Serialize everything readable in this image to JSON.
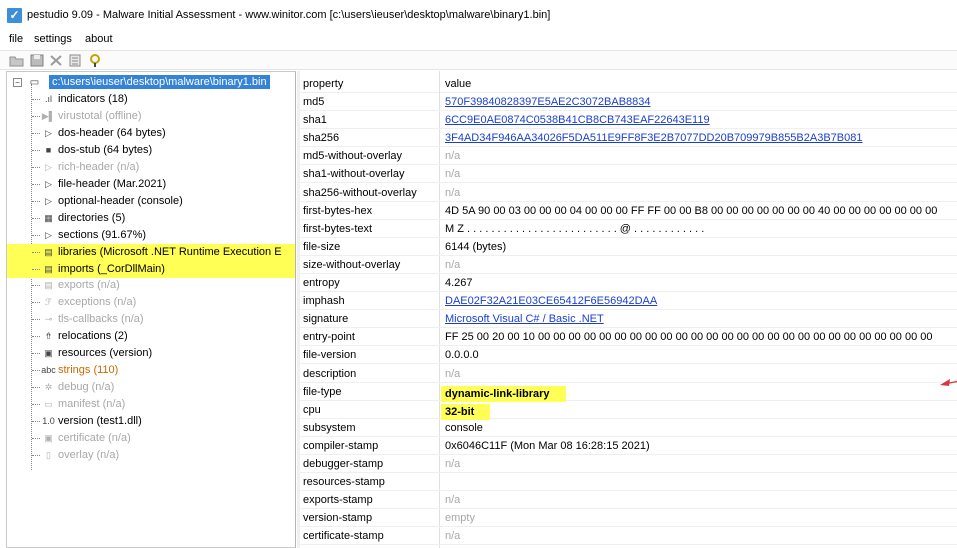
{
  "window": {
    "title": "pestudio 9.09 - Malware Initial Assessment - www.winitor.com [c:\\users\\ieuser\\desktop\\malware\\binary1.bin]"
  },
  "menu": [
    "file",
    "settings",
    "about"
  ],
  "toolbar": [
    "open-icon",
    "save-icon",
    "close-icon",
    "list-icon",
    "help-icon"
  ],
  "tree": {
    "root": "c:\\users\\ieuser\\desktop\\malware\\binary1.bin",
    "items": [
      {
        "label": "indicators (18)",
        "style": "normal",
        "icon": "indicators-icon",
        "glyph": ".ıl"
      },
      {
        "label": "virustotal (offline)",
        "style": "muted",
        "icon": "virustotal-icon",
        "glyph": "▶▌"
      },
      {
        "label": "dos-header (64 bytes)",
        "style": "normal",
        "icon": "arrow-icon",
        "glyph": "▷"
      },
      {
        "label": "dos-stub (64 bytes)",
        "style": "normal",
        "icon": "console-icon",
        "glyph": "■"
      },
      {
        "label": "rich-header (n/a)",
        "style": "muted",
        "icon": "arrow-icon",
        "glyph": "▷"
      },
      {
        "label": "file-header (Mar.2021)",
        "style": "normal",
        "icon": "arrow-icon",
        "glyph": "▷"
      },
      {
        "label": "optional-header (console)",
        "style": "normal",
        "icon": "arrow-icon",
        "glyph": "▷"
      },
      {
        "label": "directories (5)",
        "style": "normal",
        "icon": "directories-icon",
        "glyph": "▦"
      },
      {
        "label": "sections (91.67%)",
        "style": "normal",
        "icon": "arrow-icon",
        "glyph": "▷"
      },
      {
        "label": "libraries (Microsoft .NET Runtime Execution E",
        "style": "normal",
        "icon": "libraries-icon",
        "glyph": "▤",
        "highlight": true
      },
      {
        "label": "imports (_CorDllMain)",
        "style": "normal",
        "icon": "imports-icon",
        "glyph": "▤",
        "highlight": true
      },
      {
        "label": "exports (n/a)",
        "style": "muted",
        "icon": "exports-icon",
        "glyph": "▤"
      },
      {
        "label": "exceptions (n/a)",
        "style": "muted",
        "icon": "exceptions-icon",
        "glyph": "ℱ"
      },
      {
        "label": "tls-callbacks (n/a)",
        "style": "muted",
        "icon": "tls-icon",
        "glyph": "⊸"
      },
      {
        "label": "relocations (2)",
        "style": "normal",
        "icon": "relocations-icon",
        "glyph": "⇮"
      },
      {
        "label": "resources (version)",
        "style": "normal",
        "icon": "resources-icon",
        "glyph": "▣"
      },
      {
        "label": "strings (110)",
        "style": "orange",
        "icon": "strings-icon",
        "glyph": "abc"
      },
      {
        "label": "debug (n/a)",
        "style": "muted",
        "icon": "debug-icon",
        "glyph": "✲"
      },
      {
        "label": "manifest (n/a)",
        "style": "muted",
        "icon": "manifest-icon",
        "glyph": "▭"
      },
      {
        "label": "version (test1.dll)",
        "style": "normal",
        "icon": "version-icon",
        "glyph": "1.0"
      },
      {
        "label": "certificate (n/a)",
        "style": "muted",
        "icon": "certificate-icon",
        "glyph": "▣"
      },
      {
        "label": "overlay (n/a)",
        "style": "muted",
        "icon": "overlay-icon",
        "glyph": "▯"
      }
    ]
  },
  "table": {
    "header": {
      "property": "property",
      "value": "value"
    },
    "rows": [
      {
        "property": "md5",
        "value": "570F39840828397E5AE2C3072BAB8834",
        "style": "link"
      },
      {
        "property": "sha1",
        "value": "6CC9E0AE0874C0538B41CB8CB743EAF22643E119",
        "style": "link"
      },
      {
        "property": "sha256",
        "value": "3F4AD34F946AA34026F5DA511E9FF8F3E2B7077DD20B709979B855B2A3B7B081",
        "style": "link"
      },
      {
        "property": "md5-without-overlay",
        "value": "n/a",
        "style": "muted"
      },
      {
        "property": "sha1-without-overlay",
        "value": "n/a",
        "style": "muted"
      },
      {
        "property": "sha256-without-overlay",
        "value": "n/a",
        "style": "muted"
      },
      {
        "property": "first-bytes-hex",
        "value": "4D 5A 90 00 03 00 00 00 04 00 00 00 FF FF 00 00 B8 00 00 00 00 00 00 00 40 00 00 00 00 00 00 00",
        "style": "normal"
      },
      {
        "property": "first-bytes-text",
        "value": "M Z . . . . . . . . . . . . . . . . . . . . . . . . . @ . . . . . . . . . . . .",
        "style": "normal"
      },
      {
        "property": "file-size",
        "value": "6144 (bytes)",
        "style": "normal"
      },
      {
        "property": "size-without-overlay",
        "value": "n/a",
        "style": "muted"
      },
      {
        "property": "entropy",
        "value": "4.267",
        "style": "normal"
      },
      {
        "property": "imphash",
        "value": "DAE02F32A21E03CE65412F6E56942DAA",
        "style": "link"
      },
      {
        "property": "signature",
        "value": "Microsoft Visual C# / Basic .NET",
        "style": "link"
      },
      {
        "property": "entry-point",
        "value": "FF 25 00 20 00 10 00 00 00 00 00 00 00 00 00 00 00 00 00 00 00 00 00 00 00 00 00 00 00 00 00 00",
        "style": "normal"
      },
      {
        "property": "file-version",
        "value": "0.0.0.0",
        "style": "normal"
      },
      {
        "property": "description",
        "value": "n/a",
        "style": "muted"
      },
      {
        "property": "file-type",
        "value": "dynamic-link-library",
        "style": "bold-hl"
      },
      {
        "property": "cpu",
        "value": "32-bit",
        "style": "bold-hl"
      },
      {
        "property": "subsystem",
        "value": "console",
        "style": "normal"
      },
      {
        "property": "compiler-stamp",
        "value": "0x6046C11F (Mon Mar 08 16:28:15 2021)",
        "style": "normal"
      },
      {
        "property": "debugger-stamp",
        "value": "n/a",
        "style": "muted"
      },
      {
        "property": "resources-stamp",
        "value": "",
        "style": "normal"
      },
      {
        "property": "exports-stamp",
        "value": "n/a",
        "style": "muted"
      },
      {
        "property": "version-stamp",
        "value": "empty",
        "style": "muted"
      },
      {
        "property": "certificate-stamp",
        "value": "n/a",
        "style": "muted"
      }
    ]
  },
  "colors": {
    "selection": "#3583d7",
    "highlight": "#ffff55",
    "link": "#1a3fcf",
    "arrow": "#d9363e"
  }
}
